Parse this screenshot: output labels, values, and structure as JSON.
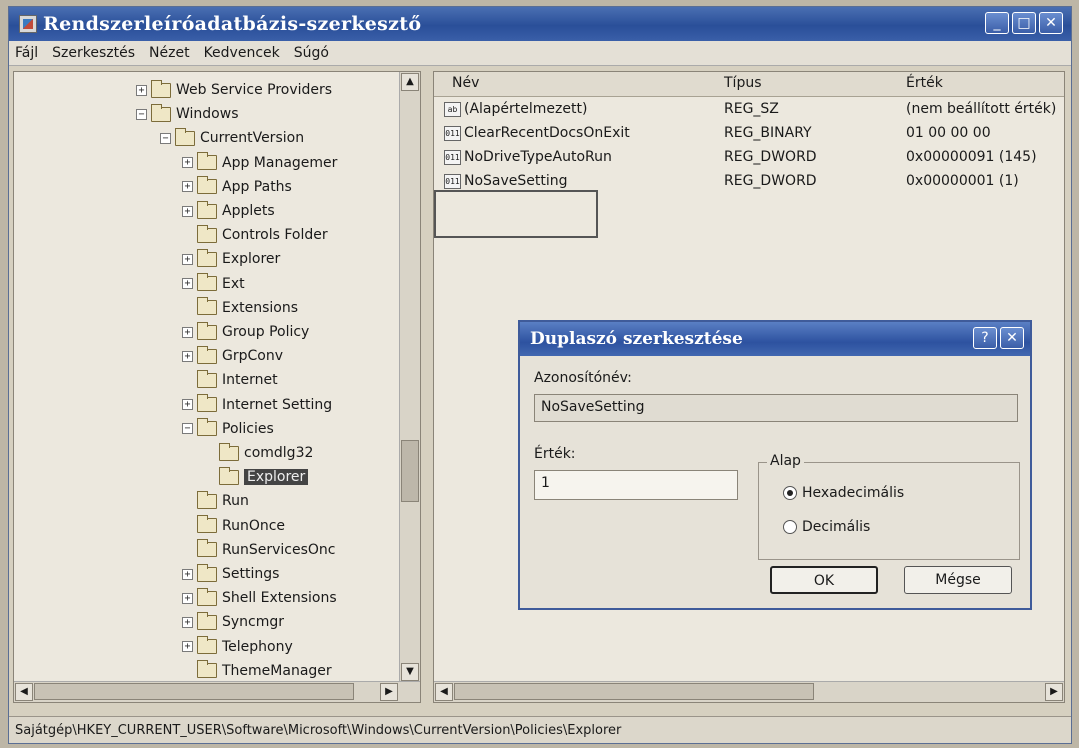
{
  "window": {
    "title": "Rendszerleíróadatbázis-szerkesztő",
    "buttons": [
      "_",
      "□",
      "✕"
    ]
  },
  "menu": [
    "Fájl",
    "Szerkesztés",
    "Nézet",
    "Kedvencek",
    "Súgó"
  ],
  "tree": [
    {
      "label": "Web Service Providers",
      "depth": 0,
      "expander": "+"
    },
    {
      "label": "Windows",
      "depth": 0,
      "expander": "-"
    },
    {
      "label": "CurrentVersion",
      "depth": 1,
      "expander": "-"
    },
    {
      "label": "App Managemer",
      "depth": 2,
      "expander": "+"
    },
    {
      "label": "App Paths",
      "depth": 2,
      "expander": "+"
    },
    {
      "label": "Applets",
      "depth": 2,
      "expander": "+"
    },
    {
      "label": "Controls Folder",
      "depth": 2,
      "expander": ""
    },
    {
      "label": "Explorer",
      "depth": 2,
      "expander": "+"
    },
    {
      "label": "Ext",
      "depth": 2,
      "expander": "+"
    },
    {
      "label": "Extensions",
      "depth": 2,
      "expander": ""
    },
    {
      "label": "Group Policy",
      "depth": 2,
      "expander": "+"
    },
    {
      "label": "GrpConv",
      "depth": 2,
      "expander": "+"
    },
    {
      "label": "Internet",
      "depth": 2,
      "expander": ""
    },
    {
      "label": "Internet Setting",
      "depth": 2,
      "expander": "+"
    },
    {
      "label": "Policies",
      "depth": 2,
      "expander": "-"
    },
    {
      "label": "comdlg32",
      "depth": 3,
      "expander": ""
    },
    {
      "label": "Explorer",
      "depth": 3,
      "expander": "",
      "selected": true
    },
    {
      "label": "Run",
      "depth": 2,
      "expander": ""
    },
    {
      "label": "RunOnce",
      "depth": 2,
      "expander": ""
    },
    {
      "label": "RunServicesOnc",
      "depth": 2,
      "expander": ""
    },
    {
      "label": "Settings",
      "depth": 2,
      "expander": "+"
    },
    {
      "label": "Shell Extensions",
      "depth": 2,
      "expander": "+"
    },
    {
      "label": "Syncmgr",
      "depth": 2,
      "expander": "+"
    },
    {
      "label": "Telephony",
      "depth": 2,
      "expander": "+"
    },
    {
      "label": "ThemeManager",
      "depth": 2,
      "expander": ""
    }
  ],
  "list": {
    "headers": {
      "name": "Név",
      "type": "Típus",
      "value": "Érték"
    },
    "rows": [
      {
        "icon": "ab",
        "name": "(Alapértelmezett)",
        "type": "REG_SZ",
        "value": "(nem beállított érték)"
      },
      {
        "icon": "011",
        "name": "ClearRecentDocsOnExit",
        "type": "REG_BINARY",
        "value": "01 00 00 00"
      },
      {
        "icon": "011",
        "name": "NoDriveTypeAutoRun",
        "type": "REG_DWORD",
        "value": "0x00000091 (145)"
      },
      {
        "icon": "011",
        "name": "NoSaveSetting",
        "type": "REG_DWORD",
        "value": "0x00000001 (1)"
      }
    ]
  },
  "dialog": {
    "title": "Duplaszó szerkesztése",
    "help_btn": "?",
    "close_btn": "✕",
    "name_label": "Azonosítónév:",
    "name_value": "NoSaveSetting",
    "value_label": "Érték:",
    "value_value": "1",
    "base_label": "Alap",
    "radio_hex": "Hexadecimális",
    "radio_dec": "Decimális",
    "ok": "OK",
    "cancel": "Mégse"
  },
  "status": "Sajátgép\\HKEY_CURRENT_USER\\Software\\Microsoft\\Windows\\CurrentVersion\\Policies\\Explorer"
}
